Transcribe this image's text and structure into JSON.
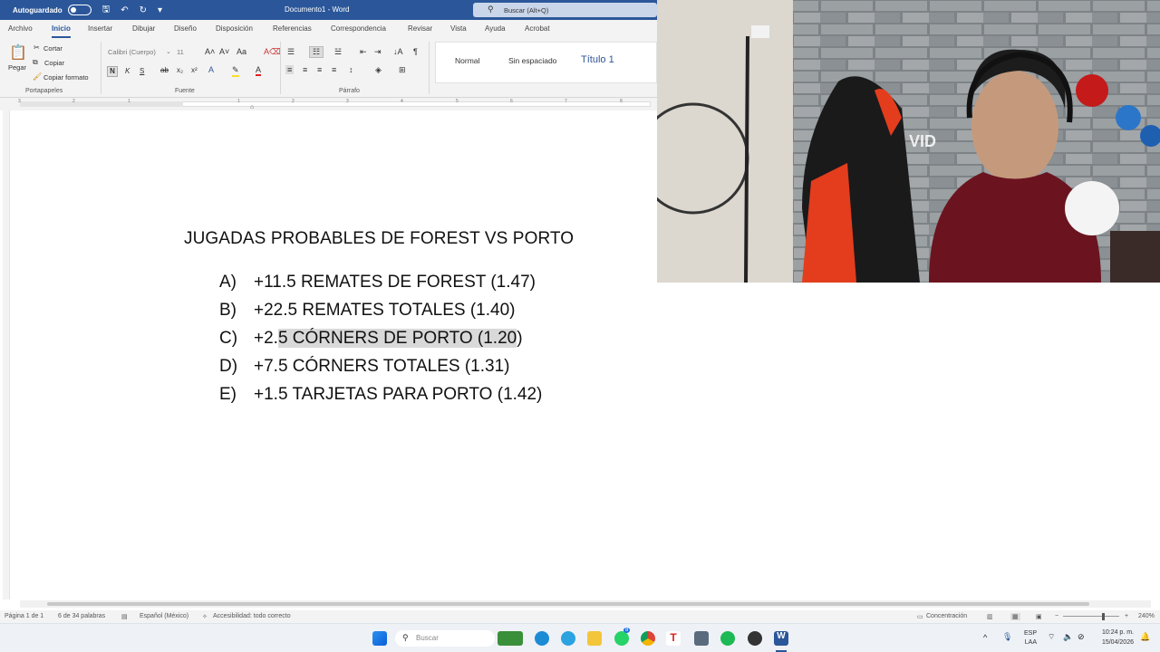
{
  "titlebar": {
    "autosave_label": "Autoguardado",
    "doc_title": "Documento1 - Word",
    "search_placeholder": "Buscar (Alt+Q)"
  },
  "tabs": [
    "Archivo",
    "Inicio",
    "Insertar",
    "Dibujar",
    "Diseño",
    "Disposición",
    "Referencias",
    "Correspondencia",
    "Revisar",
    "Vista",
    "Ayuda",
    "Acrobat"
  ],
  "ribbon": {
    "clipboard": {
      "paste": "Pegar",
      "cut": "Cortar",
      "copy": "Copiar",
      "format_painter": "Copiar formato",
      "label": "Portapapeles"
    },
    "font": {
      "name": "Calibri (Cuerpo)",
      "size": "11",
      "label": "Fuente",
      "bold": "N",
      "italic": "K",
      "underline": "S"
    },
    "paragraph": {
      "label": "Párrafo"
    },
    "styles": [
      "Normal",
      "Sin espaciado",
      "Título 1"
    ]
  },
  "ruler_ticks": [
    "3",
    "2",
    "1",
    "1",
    "2",
    "3",
    "4",
    "5",
    "6",
    "7",
    "8"
  ],
  "document": {
    "title": "JUGADAS PROBABLES DE FOREST VS PORTO",
    "items": [
      {
        "letter": "A)",
        "text": "+11.5 REMATES DE FOREST (1.47)"
      },
      {
        "letter": "B)",
        "text": "+22.5 REMATES TOTALES (1.40)"
      },
      {
        "letter": "C)",
        "text_pre": "+2.",
        "text_hl": "5 CÓRNERS DE PORTO (1.20",
        "text_post": ")"
      },
      {
        "letter": "D)",
        "text": "+7.5 CÓRNERS TOTALES (1.31)"
      },
      {
        "letter": "E)",
        "text": "+1.5 TARJETAS PARA PORTO (1.42)"
      }
    ]
  },
  "webcam": {
    "chair_text": "VID"
  },
  "statusbar": {
    "page": "Página 1 de 1",
    "words": "6 de 34 palabras",
    "language": "Español (México)",
    "accessibility": "Accesibilidad: todo correcto",
    "focus": "Concentración",
    "zoom": "240%"
  },
  "taskbar": {
    "search": "Buscar",
    "lang1": "ESP",
    "lang2": "LAA",
    "time": "10:24 p. m.",
    "date": "15/04/2026",
    "badge": "8"
  },
  "colors": {
    "word_blue": "#2b579a",
    "highlight": "#d9d9d9"
  }
}
